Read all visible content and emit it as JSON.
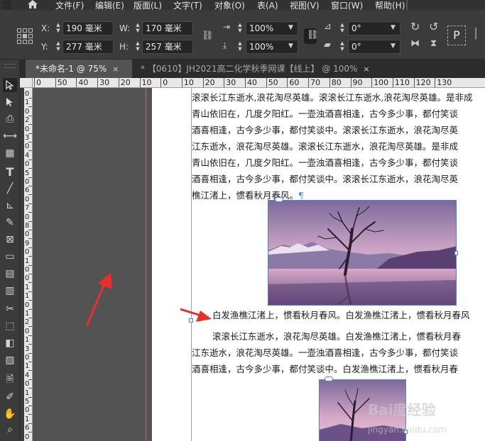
{
  "menu": {
    "items": [
      "文件(F)",
      "编辑(E)",
      "版面(L)",
      "文字(T)",
      "对象(O)",
      "表(A)",
      "视图(V)",
      "窗口(W)",
      "帮助(H)"
    ]
  },
  "control": {
    "x_label": "X:",
    "x_value": "190 毫米",
    "y_label": "Y:",
    "y_value": "277 毫米",
    "w_label": "W:",
    "w_value": "170 毫米",
    "h_label": "H:",
    "h_value": "257 毫米",
    "scale_x": "100%",
    "scale_y": "100%",
    "rotate": "0°",
    "shear": "0°",
    "p_glyph": "P"
  },
  "tabs": [
    {
      "label": "*未命名-1 @ 75%",
      "close": "×"
    },
    {
      "label": "* 【0610】JH2021高二化学秋季网课【线上】 @ 100%",
      "close": "×"
    }
  ],
  "ruler_h": [
    "0",
    "50",
    "40",
    "30",
    "20",
    "10",
    "0",
    "10",
    "20",
    "30",
    "40",
    "50",
    "60",
    "70",
    "80",
    "90",
    "100",
    "110",
    "120",
    "130"
  ],
  "ruler_v": [
    "0",
    "1",
    "0",
    "2",
    "0",
    "3",
    "0",
    "4",
    "0",
    "5",
    "0",
    "6",
    "0",
    "7",
    "0",
    "8",
    "0",
    "9",
    "0",
    "1",
    "0",
    "0",
    "1",
    "1",
    "0",
    "1",
    "2",
    "0",
    "1",
    "3",
    "0",
    "1",
    "4",
    "0",
    "1",
    "5",
    "0",
    "1",
    "6",
    "0"
  ],
  "body": {
    "lines1": [
      "滚滚长江东逝水,浪花淘尽英雄。滚滚长江东逝水,浪花淘尽英雄。是非成",
      "青山依旧在，几度夕阳红。一壶浊酒喜相逢，古今多少事，都付笑谈",
      "酒喜相逢，古今多少事，都付笑谈中。滚滚长江东逝水，浪花淘尽英",
      "江东逝水，浪花淘尽英雄。滚滚长江东逝水，浪花淘尽英雄。是非成",
      "青山依旧在，几度夕阳红。一壶浊酒喜相逢，古今多少事，都付笑谈",
      "酒喜相逢，古今多少事，都付笑谈中。滚滚长江东逝水，浪花淘尽英",
      "樵江渚上，惯看秋月春风。"
    ],
    "pilcrow": "¶",
    "caption": "白发渔樵江渚上，惯看秋月春风。白发渔樵江渚上，惯看秋月春风",
    "lines2": [
      "滚滚长江东逝水，浪花淘尽英雄。白发渔樵江渚上，惯看秋月春",
      "江东逝水，浪花淘尽英雄。一壶浊酒喜相逢，古今多少事，都付笑谈",
      "酒喜相逢，古今多少事，都付笑谈中。白发渔樵江渚上，惯看秋月春"
    ]
  },
  "watermark": {
    "brand": "Bai",
    "mid": "度",
    "tail": "经验",
    "sub": "jingyan.baidu.com"
  },
  "colors": {
    "accent_red": "#e8302a",
    "frame_blue": "#4a86e0"
  }
}
